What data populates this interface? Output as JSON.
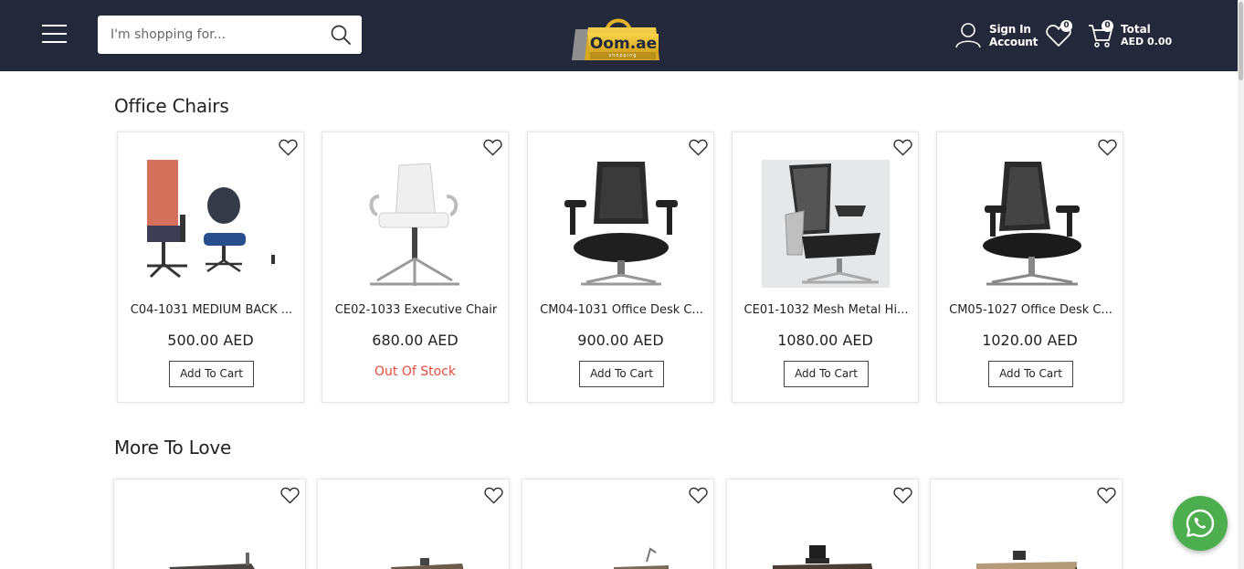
{
  "header": {
    "search_placeholder": "I'm shopping for...",
    "logo_text": "Oom.ae",
    "logo_sub": "shopping",
    "sign_in_line1": "Sign In",
    "sign_in_line2": "Account",
    "wishlist_count": "0",
    "cart_count": "0",
    "cart_total_label": "Total",
    "cart_total_value": "AED 0.00"
  },
  "sections": {
    "office_chairs_title": "Office Chairs",
    "more_to_love_title": "More To Love"
  },
  "products": [
    {
      "name": "C04-1031 MEDIUM BACK ...",
      "price": "500.00 AED",
      "action": "Add To Cart"
    },
    {
      "name": "CE02-1033 Executive Chair",
      "price": "680.00 AED",
      "status": "Out Of Stock"
    },
    {
      "name": "CM04-1031 Office Desk C...",
      "price": "900.00 AED",
      "action": "Add To Cart"
    },
    {
      "name": "CE01-1032 Mesh Metal Hi...",
      "price": "1080.00 AED",
      "action": "Add To Cart"
    },
    {
      "name": "CM05-1027 Office Desk C...",
      "price": "1020.00 AED",
      "action": "Add To Cart"
    }
  ],
  "colors": {
    "header_bg": "#23293a",
    "out_of_stock": "#e84c3d",
    "whatsapp": "#4cae4f",
    "logo_gold": "#e7b92a"
  },
  "icons": [
    "menu-icon",
    "search-icon",
    "user-icon",
    "heart-icon",
    "cart-icon",
    "whatsapp-icon"
  ]
}
